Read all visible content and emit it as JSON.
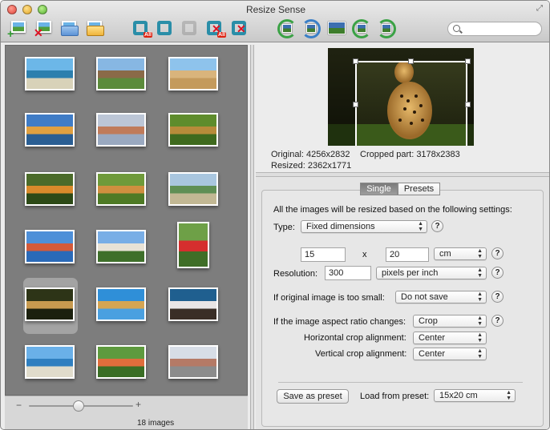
{
  "window": {
    "title": "Resize Sense"
  },
  "toolbar": {
    "buttons": [
      {
        "name": "add-images"
      },
      {
        "name": "remove-images"
      },
      {
        "name": "open-folder"
      },
      {
        "name": "open-folder-alt"
      },
      {
        "name": "crop-all",
        "badge": "All"
      },
      {
        "name": "crop-selected"
      },
      {
        "name": "crop-disabled"
      },
      {
        "name": "remove-crop-all",
        "badge": "All"
      },
      {
        "name": "remove-crop"
      },
      {
        "name": "rotate-left"
      },
      {
        "name": "rotate-right"
      },
      {
        "name": "flip"
      },
      {
        "name": "rotate-ccw"
      },
      {
        "name": "rotate-cw"
      }
    ],
    "search_placeholder": ""
  },
  "browser": {
    "image_count": "18 images",
    "zoom_minus": "−",
    "zoom_plus": "+",
    "thumbnails": [
      {
        "desc": "coast cliffs",
        "colors": [
          "#6cb7e8",
          "#2c7fae",
          "#d8d2b9"
        ]
      },
      {
        "desc": "windmills",
        "colors": [
          "#87b7e3",
          "#8a6a48",
          "#5b8b3b"
        ]
      },
      {
        "desc": "beach",
        "colors": [
          "#8ec3ec",
          "#d9b47c",
          "#c49a5c"
        ]
      },
      {
        "desc": "autumn lake",
        "colors": [
          "#3f7cc6",
          "#e0a040",
          "#2a5e93"
        ]
      },
      {
        "desc": "lake reflection",
        "colors": [
          "#bcc6d6",
          "#c07b5a",
          "#9aa9c0"
        ]
      },
      {
        "desc": "tiger in grass",
        "colors": [
          "#5e8c2c",
          "#b78b3a",
          "#3f6a1e"
        ]
      },
      {
        "desc": "tiger",
        "colors": [
          "#4b6b2a",
          "#d98a2b",
          "#2d4a17"
        ]
      },
      {
        "desc": "tiger walking",
        "colors": [
          "#6f9a3a",
          "#cf8f3f",
          "#4e7a25"
        ]
      },
      {
        "desc": "river valley",
        "colors": [
          "#a9c6df",
          "#5f8f55",
          "#c2b894"
        ]
      },
      {
        "desc": "harbor",
        "colors": [
          "#4d8fd8",
          "#d35a3a",
          "#2a6ab8"
        ]
      },
      {
        "desc": "castle",
        "colors": [
          "#79aee6",
          "#e8e2d6",
          "#3e6f2a"
        ]
      },
      {
        "desc": "person portrait",
        "colors": [
          "#6ea047",
          "#d52e2e",
          "#3f6e27"
        ]
      },
      {
        "desc": "cheetah",
        "colors": [
          "#2d3417",
          "#c79a4f",
          "#1b200e"
        ]
      },
      {
        "desc": "giraffe",
        "colors": [
          "#2f8fd8",
          "#d5a553",
          "#4aa0e0"
        ]
      },
      {
        "desc": "flamingo",
        "colors": [
          "#1f5f8f",
          "#e9e6e6",
          "#3a2e26"
        ]
      },
      {
        "desc": "sea cliffs",
        "colors": [
          "#6ab0e8",
          "#2f7fc0",
          "#e0dccc"
        ]
      },
      {
        "desc": "children in field",
        "colors": [
          "#5e9a3e",
          "#e06d3c",
          "#3a6e25"
        ]
      },
      {
        "desc": "town square",
        "colors": [
          "#d7dde6",
          "#b57a66",
          "#8c8c8c"
        ]
      }
    ]
  },
  "preview": {
    "original": "Original: 4256x2832",
    "resized": "Resized: 2362x1771",
    "cropped": "Cropped part: 3178x2383"
  },
  "settings": {
    "tabs": [
      "Single",
      "Presets"
    ],
    "intro": "All the images will be resized based on the following settings:",
    "type_label": "Type:",
    "type_value": "Fixed dimensions",
    "width": "15",
    "x_label": "x",
    "height": "20",
    "unit": "cm",
    "resolution_label": "Resolution:",
    "resolution": "300",
    "resolution_unit": "pixels per inch",
    "too_small_label": "If original image is too small:",
    "too_small_value": "Do not save",
    "aspect_label": "If the image aspect ratio changes:",
    "aspect_value": "Crop",
    "h_align_label": "Horizontal crop alignment:",
    "h_align_value": "Center",
    "v_align_label": "Vertical crop alignment:",
    "v_align_value": "Center",
    "save_preset": "Save as preset",
    "load_preset_label": "Load from preset:",
    "load_preset_value": "15x20 cm",
    "help": "?"
  }
}
